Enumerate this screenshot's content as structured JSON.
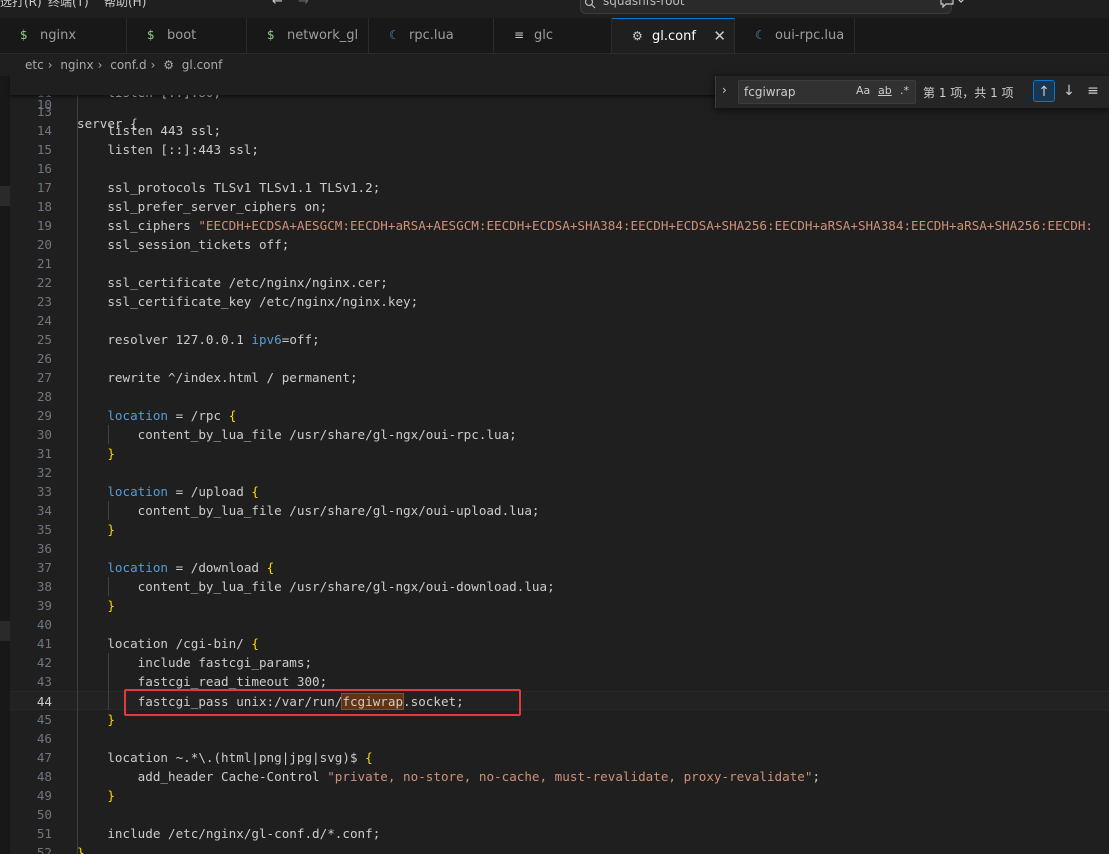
{
  "menubar": {
    "items": [
      "选打(R)",
      "终端(T)",
      "帮助(H)"
    ],
    "back_icon": "arrow-left",
    "forward_icon": "arrow-right",
    "search_label": "squashfs-root",
    "chat_icon": "chat-bubble"
  },
  "tabs": [
    {
      "label": "nginx",
      "icon": "$"
    },
    {
      "label": "boot",
      "icon": "$"
    },
    {
      "label": "network_gl",
      "icon": "$"
    },
    {
      "label": "rpc.lua",
      "icon": "☾"
    },
    {
      "label": "glc",
      "icon": "≡"
    },
    {
      "label": "gl.conf",
      "icon": "⚙",
      "active": true
    },
    {
      "label": "oui-rpc.lua",
      "icon": "☾"
    }
  ],
  "close_glyph": "✕",
  "breadcrumb": [
    "etc",
    "nginx",
    "conf.d",
    "gl.conf"
  ],
  "find": {
    "query": "fcgiwrap",
    "options": [
      "Aa",
      "ab",
      ".*"
    ],
    "count": "第 1 项，共 1 项",
    "prev_icon": "arrow-up",
    "next_icon": "arrow-down",
    "more_icon": "menu-lines"
  },
  "editor": {
    "current_line": 44,
    "sticky": {
      "n": "10",
      "code": "server {"
    },
    "lines": [
      {
        "n": "13",
        "code": ""
      },
      {
        "n": "14",
        "code": "    listen 443 ssl;"
      },
      {
        "n": "15",
        "code": "    listen [::]:443 ssl;"
      },
      {
        "n": "16",
        "code": ""
      },
      {
        "n": "17",
        "code": "    ssl_protocols TLSv1 TLSv1.1 TLSv1.2;"
      },
      {
        "n": "18",
        "code": "    ssl_prefer_server_ciphers on;"
      },
      {
        "n": "19",
        "code": "    ssl_ciphers \"EECDH+ECDSA+AESGCM:EECDH+aRSA+AESGCM:EECDH+ECDSA+SHA384:EECDH+ECDSA+SHA256:EECDH+aRSA+SHA384:EECDH+aRSA+SHA256:EECDH:"
      },
      {
        "n": "20",
        "code": "    ssl_session_tickets off;"
      },
      {
        "n": "21",
        "code": ""
      },
      {
        "n": "22",
        "code": "    ssl_certificate /etc/nginx/nginx.cer;"
      },
      {
        "n": "23",
        "code": "    ssl_certificate_key /etc/nginx/nginx.key;"
      },
      {
        "n": "24",
        "code": ""
      },
      {
        "n": "25",
        "code": "    resolver 127.0.0.1 ipv6=off;"
      },
      {
        "n": "26",
        "code": ""
      },
      {
        "n": "27",
        "code": "    rewrite ^/index.html / permanent;"
      },
      {
        "n": "28",
        "code": ""
      },
      {
        "n": "29",
        "code": "    location = /rpc {"
      },
      {
        "n": "30",
        "code": "        content_by_lua_file /usr/share/gl-ngx/oui-rpc.lua;"
      },
      {
        "n": "31",
        "code": "    }"
      },
      {
        "n": "32",
        "code": ""
      },
      {
        "n": "33",
        "code": "    location = /upload {"
      },
      {
        "n": "34",
        "code": "        content_by_lua_file /usr/share/gl-ngx/oui-upload.lua;"
      },
      {
        "n": "35",
        "code": "    }"
      },
      {
        "n": "36",
        "code": ""
      },
      {
        "n": "37",
        "code": "    location = /download {"
      },
      {
        "n": "38",
        "code": "        content_by_lua_file /usr/share/gl-ngx/oui-download.lua;"
      },
      {
        "n": "39",
        "code": "    }"
      },
      {
        "n": "40",
        "code": ""
      },
      {
        "n": "41",
        "code": "    location /cgi-bin/ {"
      },
      {
        "n": "42",
        "code": "        include fastcgi_params;"
      },
      {
        "n": "43",
        "code": "        fastcgi_read_timeout 300;"
      },
      {
        "n": "44",
        "code": "        fastcgi_pass unix:/var/run/fcgiwrap.socket;"
      },
      {
        "n": "45",
        "code": "    }"
      },
      {
        "n": "46",
        "code": ""
      },
      {
        "n": "47",
        "code": "    location ~.*\\.(html|png|jpg|svg)$ {"
      },
      {
        "n": "48",
        "code": "        add_header Cache-Control \"private, no-store, no-cache, must-revalidate, proxy-revalidate\";"
      },
      {
        "n": "49",
        "code": "    }"
      },
      {
        "n": "50",
        "code": ""
      },
      {
        "n": "51",
        "code": "    include /etc/nginx/gl-conf.d/*.conf;"
      },
      {
        "n": "52",
        "code": "}"
      }
    ]
  }
}
